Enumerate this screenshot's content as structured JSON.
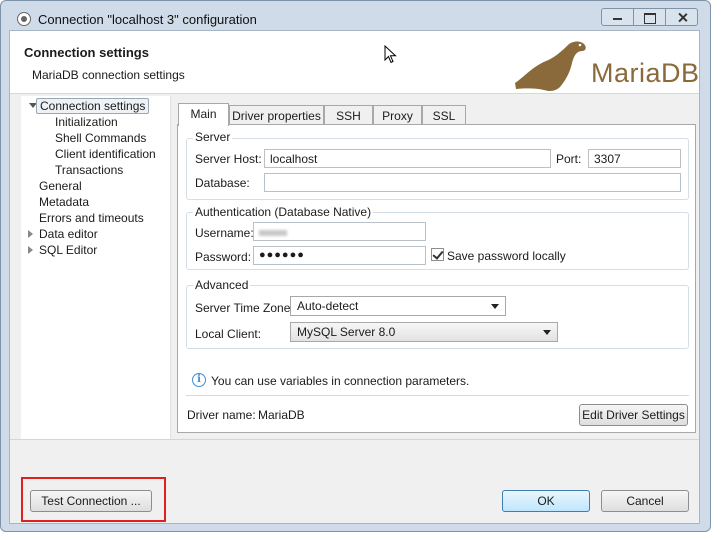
{
  "window": {
    "title": "Connection \"localhost 3\" configuration"
  },
  "header": {
    "title": "Connection settings",
    "subtitle": "MariaDB connection settings",
    "logo_text": "MariaDB"
  },
  "tree": {
    "items": [
      {
        "label": "Connection settings",
        "selected": true,
        "expandable": true,
        "expanded": true
      },
      {
        "label": "Initialization",
        "child": true
      },
      {
        "label": "Shell Commands",
        "child": true
      },
      {
        "label": "Client identification",
        "child": true
      },
      {
        "label": "Transactions",
        "child": true
      },
      {
        "label": "General"
      },
      {
        "label": "Metadata"
      },
      {
        "label": "Errors and timeouts"
      },
      {
        "label": "Data editor",
        "expandable": true
      },
      {
        "label": "SQL Editor",
        "expandable": true
      }
    ]
  },
  "tabs": [
    "Main",
    "Driver properties",
    "SSH",
    "Proxy",
    "SSL"
  ],
  "active_tab": "Main",
  "server": {
    "group_label": "Server",
    "host_label": "Server Host:",
    "host_value": "localhost",
    "port_label": "Port:",
    "port_value": "3307",
    "database_label": "Database:",
    "database_value": ""
  },
  "auth": {
    "group_label": "Authentication (Database Native)",
    "username_label": "Username:",
    "password_label": "Password:",
    "password_masked": "●●●●●●",
    "save_password_label": "Save password locally",
    "save_password_checked": true
  },
  "advanced": {
    "group_label": "Advanced",
    "timezone_label": "Server Time Zone:",
    "timezone_value": "Auto-detect",
    "local_client_label": "Local Client:",
    "local_client_value": "MySQL Server 8.0"
  },
  "info": {
    "message": "You can use variables in connection parameters."
  },
  "driver": {
    "name_label": "Driver name:",
    "name_value": "MariaDB",
    "edit_button": "Edit Driver Settings"
  },
  "buttons": {
    "test_connection": "Test Connection ...",
    "ok": "OK",
    "cancel": "Cancel"
  },
  "colors": {
    "highlight": "#e02020",
    "accent": "#3b8cd8",
    "logo": "#8a6a3a"
  }
}
